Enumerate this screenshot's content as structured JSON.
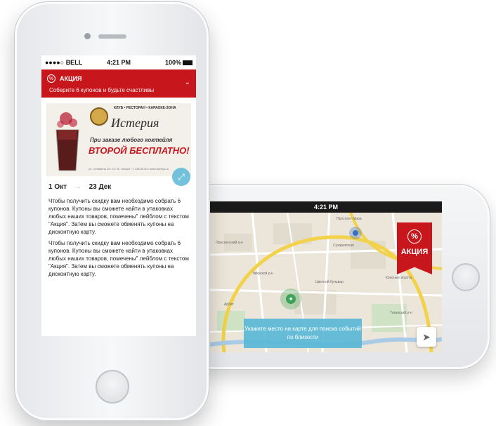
{
  "portrait": {
    "status": {
      "carrier": "BELL",
      "time": "4:21 PM",
      "battery": "100%"
    },
    "promo": {
      "icon": "percent-icon",
      "title": "АКЦИЯ",
      "subtitle": "Соберите 6 купонов и будьте счастливы"
    },
    "banner": {
      "club_tagline": "КЛУБ • РЕСТОРАН • КАРАОКЕ-ЗОНА",
      "club_name": "Истерия",
      "offer_line": "При заказе любого коктейля",
      "offer_big": "ВТОРОЙ БЕСПЛАТНО!",
      "address": "ул. Сенявина 15 / Ст. М. Озерки / т. 248 60 80 / www.isteriya.ru"
    },
    "dates": {
      "start": "1 Окт",
      "end": "23 Дек"
    },
    "description": [
      "Чтобы получить скидку вам необходимо собрать 6 купонов. Купоны вы сможете найти в упаковках любых наших товаров, помечены\" лейблом с текстом \"Акция\". Затем вы сможете обменять купоны на дисконтную карту.",
      "Чтобы получить скидку вам необходимо собрать 6 купонов. Купоны вы сможете найти в упаковках любых наших товаров, помечены\" лейблом с текстом \"Акция\". Затем вы сможете обменять купоны на дисконтную карту."
    ]
  },
  "landscape": {
    "status": {
      "time": "4:21 PM"
    },
    "ribbon": {
      "icon": "percent-icon",
      "label": "АКЦИЯ"
    },
    "hint": "Укажите место на карте для поиска событий по близости",
    "map_labels": [
      "Проспект Мира",
      "Сухаревская",
      "Тверской р-н",
      "Цветной бульвар",
      "Красные ворота",
      "Таганский р-н",
      "Пресненский р-н",
      "Арбат"
    ]
  },
  "colors": {
    "brand_red": "#c8161d",
    "hint_blue": "#5ab9d6"
  }
}
